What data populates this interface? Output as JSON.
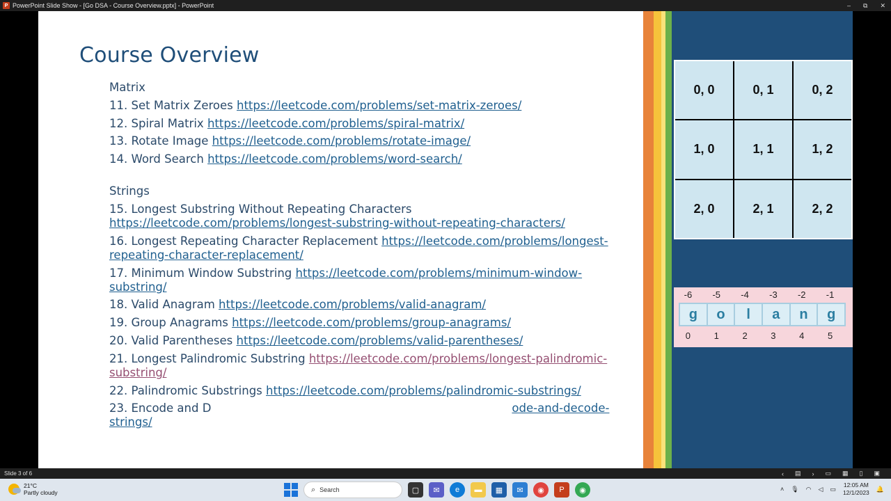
{
  "window": {
    "title": "PowerPoint Slide Show - [Go DSA - Course Overview.pptx] - PowerPoint",
    "app_icon": "P",
    "controls": [
      "–",
      "⧉",
      "✕"
    ]
  },
  "slide": {
    "title": "Course Overview",
    "matrix_heading": "Matrix",
    "matrix_items": [
      {
        "text": "11. Set Matrix Zeroes ",
        "url": "https://leetcode.com/problems/set-matrix-zeroes/"
      },
      {
        "text": "12. Spiral Matrix ",
        "url": "https://leetcode.com/problems/spiral-matrix/"
      },
      {
        "text": "13. Rotate Image ",
        "url": "https://leetcode.com/problems/rotate-image/"
      },
      {
        "text": "14. Word Search ",
        "url": "https://leetcode.com/problems/word-search/"
      }
    ],
    "strings_heading": "Strings",
    "strings_items": [
      {
        "text": "15. Longest Substring Without Repeating Characters",
        "url1": "https://leetcode.com/problems/longest-substring-without-repeating-characters/"
      },
      {
        "text": "16. Longest Repeating Character Replacement ",
        "url1": "https://leetcode.com/problems/longest-",
        "url2": "repeating-character-replacement/"
      },
      {
        "text": "17. Minimum Window Substring ",
        "url1": "https://leetcode.com/problems/minimum-window-",
        "url2": "substring/"
      },
      {
        "text": "18. Valid Anagram ",
        "url1": "https://leetcode.com/problems/valid-anagram/"
      },
      {
        "text": "19. Group Anagrams ",
        "url1": "https://leetcode.com/problems/group-anagrams/"
      },
      {
        "text": "20. Valid Parentheses ",
        "url1": "https://leetcode.com/problems/valid-parentheses/"
      },
      {
        "text": "21. Longest Palindromic Substring ",
        "url1": "https://leetcode.com/problems/longest-palindromic-",
        "url2": "substring/"
      },
      {
        "text": "22. Palindromic Substrings ",
        "url1": "https://leetcode.com/problems/palindromic-substrings/"
      },
      {
        "text": "23. Encode and D",
        "url1": "ode-and-decode-",
        "url2": "strings/"
      }
    ],
    "grid_cells": [
      "0, 0",
      "0, 1",
      "0, 2",
      "1, 0",
      "1, 1",
      "1, 2",
      "2, 0",
      "2, 1",
      "2, 2"
    ],
    "string_neg_idx": [
      "-6",
      "-5",
      "-4",
      "-3",
      "-2",
      "-1"
    ],
    "string_chars": [
      "g",
      "o",
      "l",
      "a",
      "n",
      "g"
    ],
    "string_pos_idx": [
      "0",
      "1",
      "2",
      "3",
      "4",
      "5"
    ],
    "colors": {
      "stripe_orange": "#e8833a",
      "stripe_yellow": "#f6c33b",
      "stripe_light_yellow": "#fbe27a",
      "stripe_green": "#6db04a",
      "panel_blue": "#1f4e79"
    }
  },
  "statusbar": {
    "slide_counter": "Slide 3 of 6",
    "icons": [
      "prev-icon",
      "slide-list-icon",
      "next-icon",
      "normal-view-icon",
      "sorter-view-icon",
      "reading-view-icon",
      "slideshow-icon"
    ]
  },
  "taskbar": {
    "temperature": "21°C",
    "condition": "Partly cloudy",
    "search_placeholder": "Search",
    "time": "12:05 AM",
    "date": "12/1/2023"
  }
}
